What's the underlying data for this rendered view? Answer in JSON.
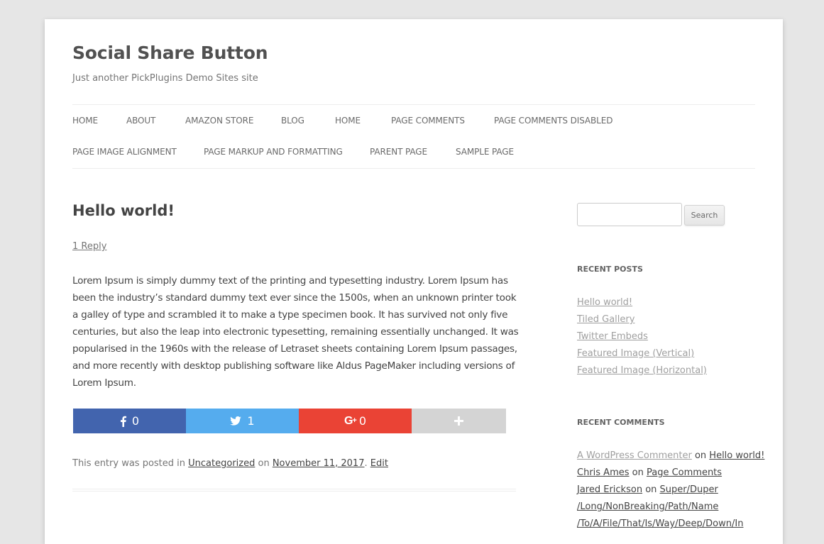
{
  "site": {
    "title": "Social Share Button",
    "description": "Just another PickPlugins Demo Sites site"
  },
  "nav": {
    "items": [
      {
        "label": "Home"
      },
      {
        "label": "About"
      },
      {
        "label": "Amazon Store"
      },
      {
        "label": "Blog"
      },
      {
        "label": "Home"
      },
      {
        "label": "Page Comments"
      },
      {
        "label": "Page Comments Disabled"
      },
      {
        "label": "Page Image Alignment"
      },
      {
        "label": "Page Markup and Formatting"
      },
      {
        "label": "Parent Page"
      },
      {
        "label": "Sample Page"
      }
    ]
  },
  "post": {
    "title": "Hello world!",
    "reply_link": "1 Reply",
    "content": "Lorem Ipsum is simply dummy text of the printing and typesetting industry. Lorem Ipsum has been the industry’s standard dummy text ever since the 1500s, when an unknown printer took a galley of type and scrambled it to make a type specimen book. It has survived not only five centuries, but also the leap into electronic typesetting, remaining essentially unchanged. It was popularised in the 1960s with the release of Letraset sheets containing Lorem Ipsum passages, and more recently with desktop publishing software like Aldus PageMaker including versions of Lorem Ipsum.",
    "share": {
      "facebook": {
        "icon": "facebook-icon",
        "count": "0",
        "color": "#4264ae"
      },
      "twitter": {
        "icon": "twitter-icon",
        "count": "1",
        "color": "#55acee"
      },
      "googleplus": {
        "icon": "google-plus-icon",
        "count": "0",
        "color": "#ea4335"
      },
      "more": {
        "icon": "plus-icon",
        "color": "#d4d4d4"
      }
    },
    "meta": {
      "prefix": "This entry was posted in ",
      "category": "Uncategorized",
      "on": " on ",
      "date": "November 11, 2017",
      "period": ". ",
      "edit": "Edit"
    }
  },
  "sidebar": {
    "search": {
      "value": "",
      "placeholder": "",
      "button_label": "Search"
    },
    "recent_posts": {
      "title": "Recent Posts",
      "items": [
        "Hello world!",
        "Tiled Gallery",
        "Twitter Embeds",
        "Featured Image (Vertical)",
        "Featured Image (Horizontal)"
      ]
    },
    "recent_comments": {
      "title": "Recent Comments",
      "items": [
        {
          "author": "A WordPress Commenter",
          "on": " on ",
          "post": "Hello world!"
        },
        {
          "author": "Chris Ames",
          "on": " on ",
          "post": "Page Comments"
        },
        {
          "author": "Jared Erickson",
          "on": " on ",
          "post": "Super/Duper",
          "post_cont": [
            "/Long/NonBreaking/Path/Name",
            "/To/A/File/That/Is/Way/Deep/Down/In"
          ]
        }
      ]
    }
  }
}
